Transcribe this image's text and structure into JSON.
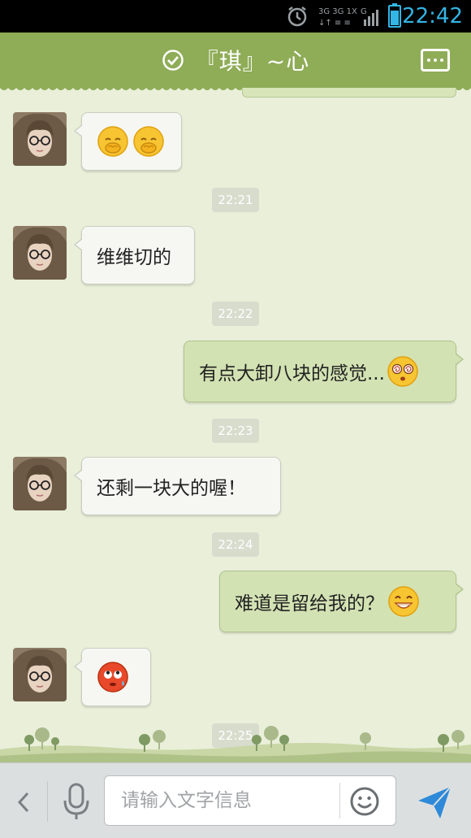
{
  "status_bar": {
    "time": "22:42",
    "network": "3G 3G 1X G",
    "icons": [
      "alarm-icon",
      "network-type-icon",
      "signal-icon",
      "battery-icon"
    ]
  },
  "header": {
    "title": "『琪』~心",
    "icons": [
      "online-check-icon",
      "more-options-icon"
    ]
  },
  "messages": [
    {
      "side": "in",
      "type": "emoji",
      "emoji": [
        "shy-face-emoji",
        "shy-face-emoji"
      ]
    },
    {
      "type": "time",
      "text": "22:21"
    },
    {
      "side": "in",
      "type": "text",
      "text": "维维切的"
    },
    {
      "type": "time",
      "text": "22:22"
    },
    {
      "side": "out",
      "type": "text",
      "text": "有点大卸八块的感觉...",
      "emoji": "dizzy-face-emoji"
    },
    {
      "type": "time",
      "text": "22:23"
    },
    {
      "side": "in",
      "type": "text",
      "text": "还剩一块大的喔！"
    },
    {
      "type": "time",
      "text": "22:24"
    },
    {
      "side": "out",
      "type": "text",
      "text": "难道是留给我的？",
      "emoji": "grinning-face-emoji"
    },
    {
      "side": "in",
      "type": "emoji",
      "emoji": [
        "eye-roll-sweat-emoji"
      ]
    },
    {
      "type": "time",
      "text": "22:25"
    }
  ],
  "input_bar": {
    "placeholder": "请输入文字信息",
    "icons": [
      "back-chevron-icon",
      "microphone-icon",
      "emoji-smiley-icon",
      "send-icon"
    ]
  },
  "colors": {
    "title_bar": "#8fac57",
    "chat_bg": "#e9efd9",
    "bubble_in": "#f6f7f2",
    "bubble_out": "#d3e2b3",
    "status_time": "#33b5e5",
    "send_icon": "#2e8ad8"
  }
}
